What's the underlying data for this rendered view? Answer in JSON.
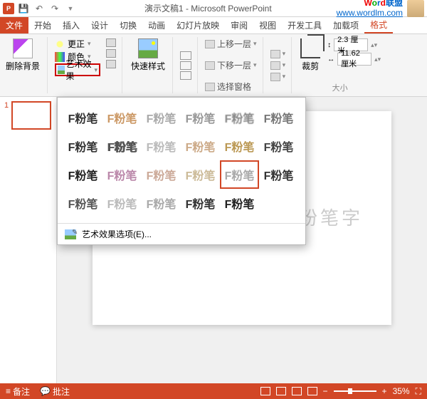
{
  "title": "演示文稿1 - Microsoft PowerPoint",
  "watermark": {
    "brand_w": "W",
    "brand_o": "o",
    "brand_r": "r",
    "brand_d": "d",
    "brand_rest": "联盟",
    "url": "www.wordlm.com"
  },
  "tabs": {
    "file": "文件",
    "home": "开始",
    "insert": "插入",
    "design": "设计",
    "transition": "切换",
    "animation": "动画",
    "slideshow": "幻灯片放映",
    "review": "审阅",
    "view": "视图",
    "developer": "开发工具",
    "addins": "加载项",
    "format": "格式"
  },
  "ribbon": {
    "removebg": "删除背景",
    "corrections": "更正",
    "color": "颜色",
    "artistic": "艺术效果",
    "quickstyles": "快速样式",
    "bringfront": "上移一层",
    "sendback": "下移一层",
    "selectionpane": "选择窗格",
    "crop": "裁剪",
    "height": "2.3 厘米",
    "width": "11.62 厘米",
    "grp_size": "大小"
  },
  "dropdown": {
    "sample": "F粉笔",
    "options": "艺术效果选项(E)..."
  },
  "slide": {
    "num": "1",
    "text": "制作粉笔字"
  },
  "status": {
    "notes": "备注",
    "comments": "批注",
    "zoom": "35%"
  }
}
